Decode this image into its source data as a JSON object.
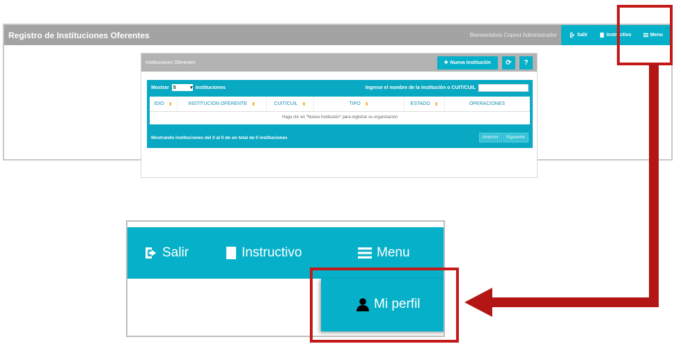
{
  "app": {
    "title": "Registro de Instituciones Oferentes",
    "welcome": "Bienvenido/a Copest Administrador",
    "nav": {
      "salir": "Salir",
      "instructivo": "Instructivo",
      "menu": "Menu"
    }
  },
  "panel": {
    "title": "Instituciones Oferentes",
    "new_button": "Nueva institución",
    "refresh_icon": "refresh-icon",
    "help_icon": "help-icon"
  },
  "table": {
    "show_label": "Mostrar",
    "page_size": "5",
    "show_suffix": "instituciones",
    "search_label": "Ingrese el nombre de la institución o CUIT/CUIL",
    "search_value": "",
    "columns": [
      "IDIO",
      "INSTITUCION OFERENTE",
      "CUIT/CUIL",
      "TIPO",
      "ESTADO",
      "OPERACIONES"
    ],
    "empty_message": "Haga clic en \"Nueva Institución\" para registrar su organización",
    "info": "Mostrando instituciones del 0 al 0 de un total de 0 instituciones",
    "prev": "Anterior",
    "next": "Siguiente"
  },
  "zoom": {
    "salir": "Salir",
    "instructivo": "Instructivo",
    "menu": "Menu",
    "mi_perfil": "Mi perfil"
  },
  "colors": {
    "accent": "#06b0c8",
    "highlight": "#c31919",
    "header_gray": "#a3a3a3"
  }
}
